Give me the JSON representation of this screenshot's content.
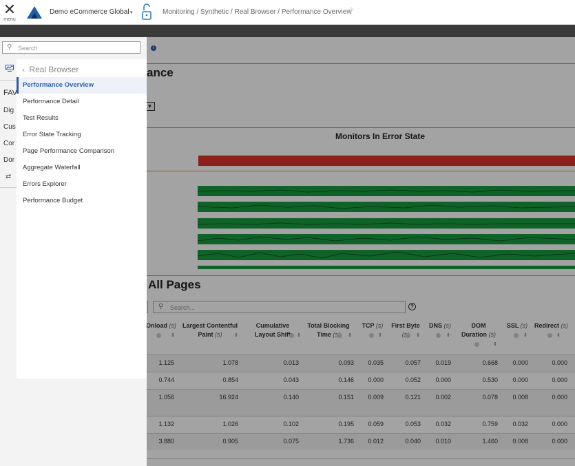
{
  "topbar": {
    "menu_icon": "close-icon",
    "menu_label": "menu",
    "org_name": "Demo eCommerce Global",
    "org_caret": "▾",
    "breadcrumb": "Monitoring / Synthetic / Real Browser / Performance Overview"
  },
  "main": {
    "page_heading": "ance",
    "error_state_title": "Monitors In Error State",
    "all_pages_heading": "All Pages",
    "table_search_placeholder": "Search...",
    "columns": [
      {
        "label": "Onload",
        "unit": "(s)"
      },
      {
        "label": "Largest Contentful Paint",
        "unit": "(s)"
      },
      {
        "label": "Cumulative Layout Shift",
        "unit": ""
      },
      {
        "label": "Total Blocking Time",
        "unit": "(s)"
      },
      {
        "label": "TCP",
        "unit": "(s)"
      },
      {
        "label": "First Byte",
        "unit": "(s)"
      },
      {
        "label": "DNS",
        "unit": "(s)"
      },
      {
        "label": "DOM Duration",
        "unit": "(s)"
      },
      {
        "label": "SSL",
        "unit": "(s)"
      },
      {
        "label": "Redirect",
        "unit": "(s)"
      }
    ],
    "rows": [
      [
        "1.125",
        "1.078",
        "0.013",
        "0.093",
        "0.035",
        "0.057",
        "0.019",
        "0.668",
        "0.000",
        "0.000"
      ],
      [
        "0.744",
        "0.854",
        "0.043",
        "0.146",
        "0.000",
        "0.052",
        "0.000",
        "0.530",
        "0.000",
        "0.000"
      ],
      [
        "1.056",
        "16.924",
        "0.140",
        "0.151",
        "0.009",
        "0.121",
        "0.002",
        "0.078",
        "0.008",
        "0.000"
      ],
      [
        "1.132",
        "1.026",
        "0.102",
        "0.195",
        "0.059",
        "0.053",
        "0.032",
        "0.759",
        "0.032",
        "0.000"
      ],
      [
        "3.880",
        "0.905",
        "0.075",
        "1.736",
        "0.012",
        "0.040",
        "0.010",
        "1.460",
        "0.008",
        "0.000"
      ]
    ]
  },
  "sidenav": {
    "search_placeholder": "Search",
    "rail": {
      "fav_label": "FAV",
      "items": [
        "Dig",
        "Cus",
        "Cor",
        "Dor"
      ]
    },
    "section_title": "Real Browser",
    "items": [
      {
        "label": "Performance Overview",
        "active": true
      },
      {
        "label": "Performance Detail",
        "active": false
      },
      {
        "label": "Test Results",
        "active": false
      },
      {
        "label": "Error State Tracking",
        "active": false
      },
      {
        "label": "Page Performance Comparison",
        "active": false
      },
      {
        "label": "Aggregate Waterfall",
        "active": false
      },
      {
        "label": "Errors Explorer",
        "active": false
      },
      {
        "label": "Performance Budget",
        "active": false
      }
    ]
  },
  "colors": {
    "accent": "#2a5db0",
    "error_red": "#d9322b",
    "ok_green": "#1a9b3f",
    "orange_rule": "#e08a3c"
  }
}
